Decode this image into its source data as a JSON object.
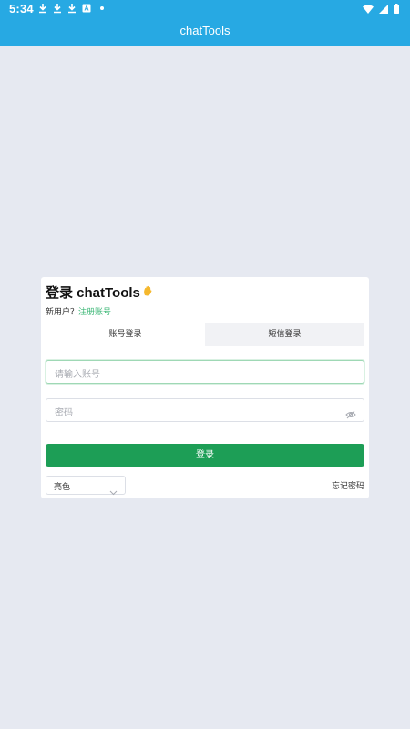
{
  "status_bar": {
    "time": "5:34",
    "icons": [
      "download-icon",
      "download-icon",
      "download-icon",
      "a-box-icon",
      "dot-icon"
    ],
    "right_icons": [
      "wifi-icon",
      "signal-icon",
      "battery-icon"
    ]
  },
  "app_bar": {
    "title": "chatTools"
  },
  "login": {
    "title": "登录 chatTools",
    "title_icon": "waving-hand-icon",
    "new_user_prefix": "新用户？",
    "register_link": "注册账号",
    "tabs": [
      {
        "label": "账号登录",
        "active": true
      },
      {
        "label": "短信登录",
        "active": false
      }
    ],
    "account_placeholder": "请输入账号",
    "password_placeholder": "密码",
    "submit_label": "登录",
    "theme_select_value": "亮色",
    "forgot_password": "忘记密码"
  },
  "colors": {
    "header": "#27a9e3",
    "primary_button": "#1d9e56",
    "link": "#3cb776",
    "background": "#e6e9f1"
  }
}
